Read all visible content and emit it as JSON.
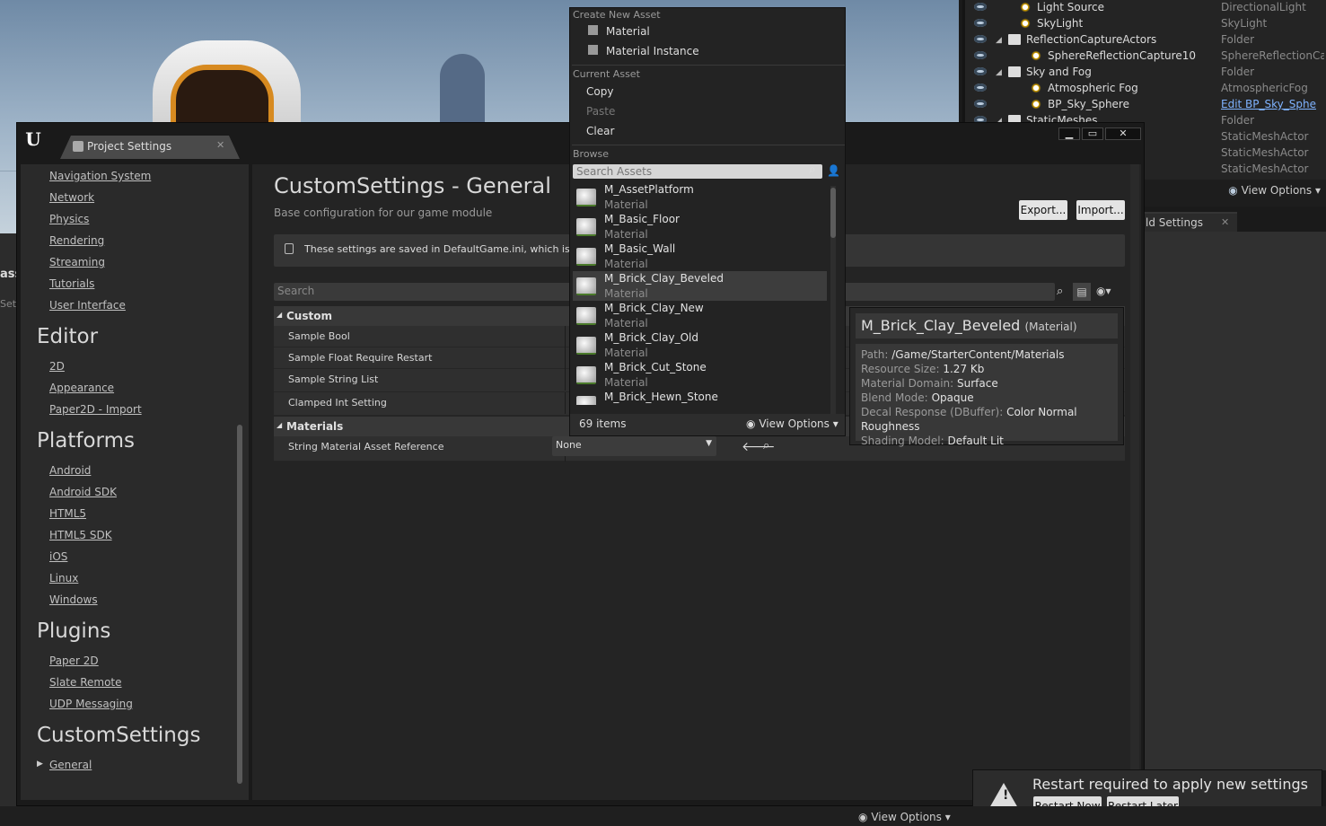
{
  "outliner": {
    "rows": [
      {
        "name": "Light Source",
        "type": "DirectionalLight",
        "icon": "directional-light-icon"
      },
      {
        "name": "SkyLight",
        "type": "SkyLight",
        "icon": "skylight-icon"
      },
      {
        "name": "ReflectionCaptureActors",
        "type": "Folder",
        "icon": "folder-icon"
      },
      {
        "name": "SphereReflectionCapture10",
        "type": "SphereReflectionCa",
        "icon": "reflection-capture-icon"
      },
      {
        "name": "Sky and Fog",
        "type": "Folder",
        "icon": "folder-icon"
      },
      {
        "name": "Atmospheric Fog",
        "type": "AtmosphericFog",
        "icon": "fog-icon"
      },
      {
        "name": "BP_Sky_Sphere",
        "type": "Edit BP_Sky_Sphe",
        "icon": "sphere-icon"
      },
      {
        "name": "StaticMeshes",
        "type": "Folder",
        "icon": "folder-icon"
      },
      {
        "name": "",
        "type": "StaticMeshActor",
        "icon": ""
      },
      {
        "name": "",
        "type": "StaticMeshActor",
        "icon": ""
      },
      {
        "name": "",
        "type": "StaticMeshActor",
        "icon": ""
      }
    ],
    "view_options": "View Options"
  },
  "world_settings_tab": "ld Settings",
  "window": {
    "tab_title": "Project Settings",
    "controls": {
      "minimize": "▁",
      "maximize": "▭",
      "close": "✕"
    }
  },
  "sidebar": {
    "top_items": [
      "Navigation System",
      "Network",
      "Physics",
      "Rendering",
      "Streaming",
      "Tutorials",
      "User Interface"
    ],
    "editor_head": "Editor",
    "editor_items": [
      "2D",
      "Appearance",
      "Paper2D - Import"
    ],
    "platforms_head": "Platforms",
    "platform_items": [
      "Android",
      "Android SDK",
      "HTML5",
      "HTML5 SDK",
      "iOS",
      "Linux",
      "Windows"
    ],
    "plugins_head": "Plugins",
    "plugin_items": [
      "Paper 2D",
      "Slate Remote",
      "UDP Messaging"
    ],
    "custom_head": "CustomSettings",
    "custom_items": [
      "General"
    ]
  },
  "content": {
    "title": "CustomSettings - General",
    "subtitle": "Base configuration for our game module",
    "export_label": "Export...",
    "import_label": "Import...",
    "notice": "These settings are saved in DefaultGame.ini, which is curre",
    "search_placeholder": "Search",
    "custom_category": "Custom",
    "custom_props": [
      "Sample Bool",
      "Sample Float Require Restart",
      "Sample String List",
      "Clamped Int Setting"
    ],
    "materials_category": "Materials",
    "material_prop": "String Material Asset Reference",
    "material_value": "None"
  },
  "menu": {
    "create_header": "Create New Asset",
    "create_items": [
      "Material",
      "Material Instance"
    ],
    "current_header": "Current Asset",
    "copy": "Copy",
    "paste": "Paste",
    "clear": "Clear",
    "browse_header": "Browse",
    "search_placeholder": "Search Assets",
    "assets": [
      {
        "name": "M_AssetPlatform",
        "type": "Material"
      },
      {
        "name": "M_Basic_Floor",
        "type": "Material"
      },
      {
        "name": "M_Basic_Wall",
        "type": "Material"
      },
      {
        "name": "M_Brick_Clay_Beveled",
        "type": "Material",
        "selected": true
      },
      {
        "name": "M_Brick_Clay_New",
        "type": "Material"
      },
      {
        "name": "M_Brick_Clay_Old",
        "type": "Material"
      },
      {
        "name": "M_Brick_Cut_Stone",
        "type": "Material"
      },
      {
        "name": "M_Brick_Hewn_Stone",
        "type": "Material"
      }
    ],
    "item_count": "69 items",
    "view_options": "View Options"
  },
  "tooltip": {
    "name": "M_Brick_Clay_Beveled",
    "kind": "(Material)",
    "fields": [
      {
        "label": "Path:",
        "value": "/Game/StarterContent/Materials"
      },
      {
        "label": "Resource Size:",
        "value": "1.27 Kb"
      },
      {
        "label": "Material Domain:",
        "value": "Surface"
      },
      {
        "label": "Blend Mode:",
        "value": "Opaque"
      },
      {
        "label": "Decal Response (DBuffer):",
        "value": "Color Normal Roughness"
      },
      {
        "label": "Shading Model:",
        "value": "Default Lit"
      }
    ]
  },
  "toast": {
    "message": "Restart required to apply new settings",
    "restart_now": "Restart Now",
    "restart_later": "Restart Later"
  },
  "status": {
    "view_options": "View Options"
  },
  "left_strip": {
    "labels": [
      "ass",
      "Sett"
    ]
  }
}
